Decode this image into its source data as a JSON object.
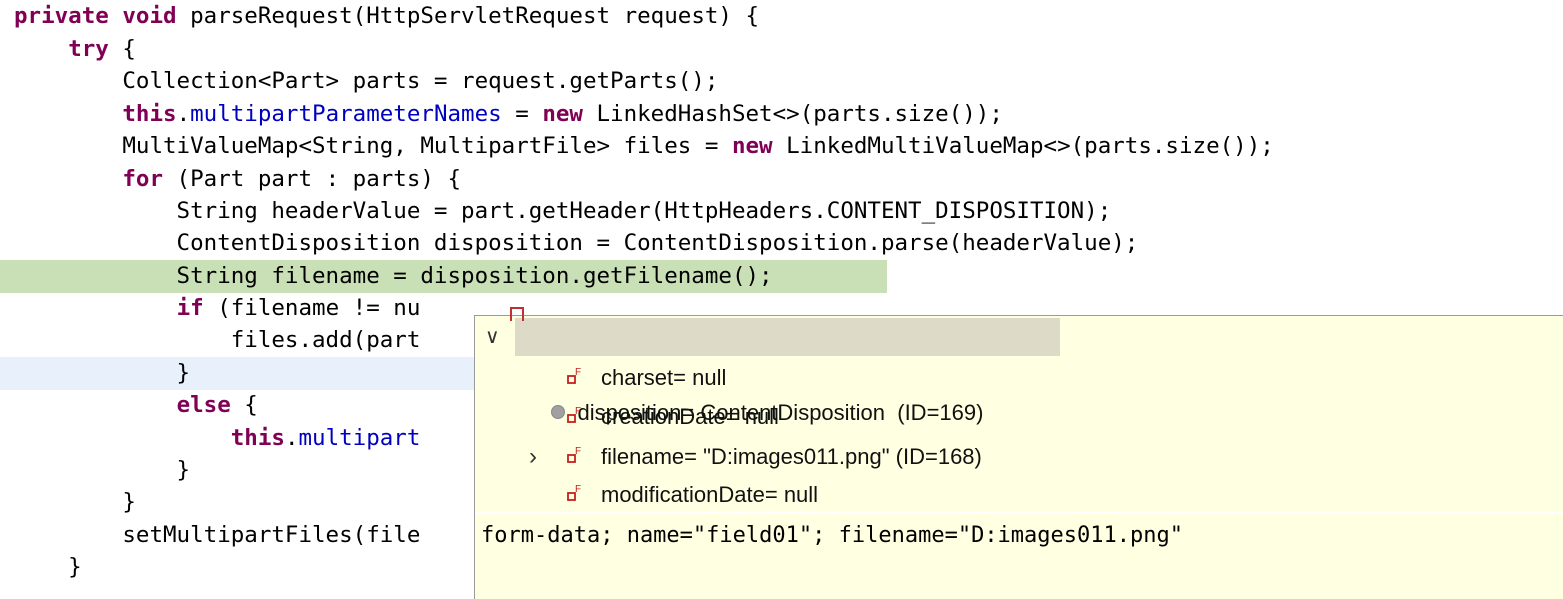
{
  "editor": {
    "lines": [
      {
        "tokens": [
          {
            "t": "private",
            "k": true
          },
          {
            "t": " "
          },
          {
            "t": "void",
            "k": true
          },
          {
            "t": " parseRequest(HttpServletRequest request) {"
          }
        ]
      },
      {
        "tokens": [
          {
            "t": "    "
          },
          {
            "t": "try",
            "k": true
          },
          {
            "t": " {"
          }
        ]
      },
      {
        "tokens": [
          {
            "t": "        Collection<Part> parts = request.getParts();"
          }
        ]
      },
      {
        "tokens": [
          {
            "t": "        "
          },
          {
            "t": "this",
            "k": true
          },
          {
            "t": "."
          },
          {
            "t": "multipartParameterNames",
            "f": true
          },
          {
            "t": " = "
          },
          {
            "t": "new",
            "k": true
          },
          {
            "t": " LinkedHashSet<>(parts.size());"
          }
        ]
      },
      {
        "tokens": [
          {
            "t": "        MultiValueMap<String, MultipartFile> files = "
          },
          {
            "t": "new",
            "k": true
          },
          {
            "t": " LinkedMultiValueMap<>(parts.size());"
          }
        ]
      },
      {
        "tokens": [
          {
            "t": "        "
          },
          {
            "t": "for",
            "k": true
          },
          {
            "t": " (Part part : parts) {"
          }
        ]
      },
      {
        "tokens": [
          {
            "t": "            String headerValue = part.getHeader(HttpHeaders.CONTENT_DISPOSITION);"
          }
        ]
      },
      {
        "tokens": [
          {
            "t": "            ContentDisposition disposition = ContentDisposition.parse(headerValue);"
          }
        ]
      },
      {
        "tokens": [
          {
            "t": "            String filename = disposition.getFilename();"
          }
        ],
        "exec": true
      },
      {
        "tokens": [
          {
            "t": "            "
          },
          {
            "t": "if",
            "k": true
          },
          {
            "t": " (filename != nu"
          }
        ]
      },
      {
        "tokens": [
          {
            "t": "                files.add(part"
          }
        ]
      },
      {
        "tokens": [
          {
            "t": "            }"
          }
        ],
        "current": true
      },
      {
        "tokens": [
          {
            "t": "            "
          },
          {
            "t": "else",
            "k": true
          },
          {
            "t": " {"
          }
        ]
      },
      {
        "tokens": [
          {
            "t": "                "
          },
          {
            "t": "this",
            "k": true
          },
          {
            "t": "."
          },
          {
            "t": "multipart",
            "f": true
          }
        ]
      },
      {
        "tokens": [
          {
            "t": "            }"
          }
        ]
      },
      {
        "tokens": [
          {
            "t": "        }"
          }
        ]
      },
      {
        "tokens": [
          {
            "t": "        setMultipartFiles(file"
          }
        ]
      },
      {
        "tokens": [
          {
            "t": "    }"
          }
        ]
      }
    ]
  },
  "hover": {
    "root": {
      "label": "disposition= ContentDisposition  (ID=169)",
      "expanded": true,
      "icon": "object-icon"
    },
    "fields": [
      {
        "label": "charset= null",
        "expandable": false,
        "icon": "field-final-icon"
      },
      {
        "label": "creationDate= null",
        "expandable": false,
        "icon": "field-final-icon"
      },
      {
        "label": "filename= \"D:images011.png\" (ID=168)",
        "expandable": true,
        "icon": "field-final-icon"
      },
      {
        "label": "modificationDate= null",
        "expandable": false,
        "icon": "field-final-icon"
      }
    ],
    "detail": "form-data; name=\"field01\"; filename=\"D:images011.png\""
  },
  "colors": {
    "keyword": "#7f0055",
    "field": "#0000c0",
    "exec_highlight": "#c9dfb5",
    "hover_bg": "#ffffe1"
  }
}
